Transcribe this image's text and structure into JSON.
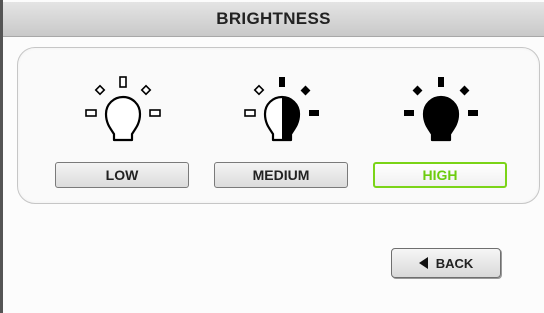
{
  "header": {
    "title": "BRIGHTNESS"
  },
  "brightness": {
    "options": [
      {
        "label": "LOW",
        "icon": "bulb-low-icon"
      },
      {
        "label": "MEDIUM",
        "icon": "bulb-medium-icon"
      },
      {
        "label": "HIGH",
        "icon": "bulb-high-icon"
      }
    ],
    "selected": "HIGH",
    "accent_color": "#7bd418"
  },
  "footer": {
    "back_label": "BACK",
    "back_icon": "left-triangle-icon"
  }
}
